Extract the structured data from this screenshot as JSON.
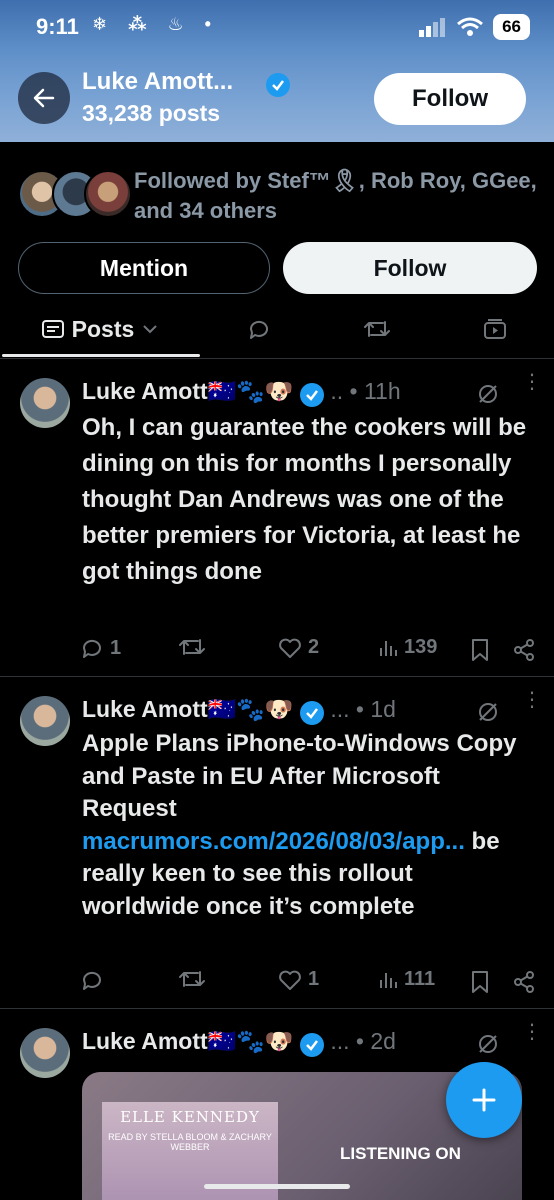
{
  "status_bar": {
    "time": "9:11",
    "notif_icons": "❄ ⁂ ♨ •",
    "battery": "66"
  },
  "header": {
    "name": "Luke Amott...",
    "posts_count": "33,238 posts",
    "follow_label": "Follow"
  },
  "profile": {
    "followed_by": "Followed by Stef™🎗, Rob Roy, GGee, and 34 others",
    "mention_label": "Mention",
    "follow_label": "Follow"
  },
  "tabs": {
    "posts_label": "Posts"
  },
  "posts": [
    {
      "author": "Luke Amott🇦🇺🐾🐶",
      "meta": ".. • 11h",
      "text": "Oh, I can guarantee the cookers will be dining on this for months I personally thought Dan Andrews was one of the better premiers for Victoria, at least he got things done",
      "replies": "1",
      "reposts": "",
      "likes": "2",
      "views": "139"
    },
    {
      "author": "Luke Amott🇦🇺🐾🐶",
      "meta": "... • 1d",
      "text_before": "Apple Plans iPhone-to-Windows Copy and Paste in EU After Microsoft Request ",
      "link": "macrumors.com/2026/08/03/app...",
      "text_after": " be really keen to see this rollout worldwide once it’s complete",
      "replies": "",
      "reposts": "",
      "likes": "1",
      "views": "111"
    },
    {
      "author": "Luke Amott🇦🇺🐾🐶",
      "meta": "... • 2d",
      "media": {
        "book_author": "ELLE KENNEDY",
        "read_by": "READ BY STELLA BLOOM & ZACHARY WEBBER",
        "listening": "LISTENING ON"
      }
    }
  ],
  "colors": {
    "accent": "#1d9bf0",
    "text": "#e7e9ea",
    "muted": "#71767b",
    "border": "#2f3336"
  },
  "icons": [
    "back-arrow-icon",
    "verified-badge-icon",
    "reply-icon",
    "repost-icon",
    "like-icon",
    "views-icon",
    "bookmark-icon",
    "share-icon",
    "grok-icon",
    "more-icon",
    "compose-icon"
  ]
}
